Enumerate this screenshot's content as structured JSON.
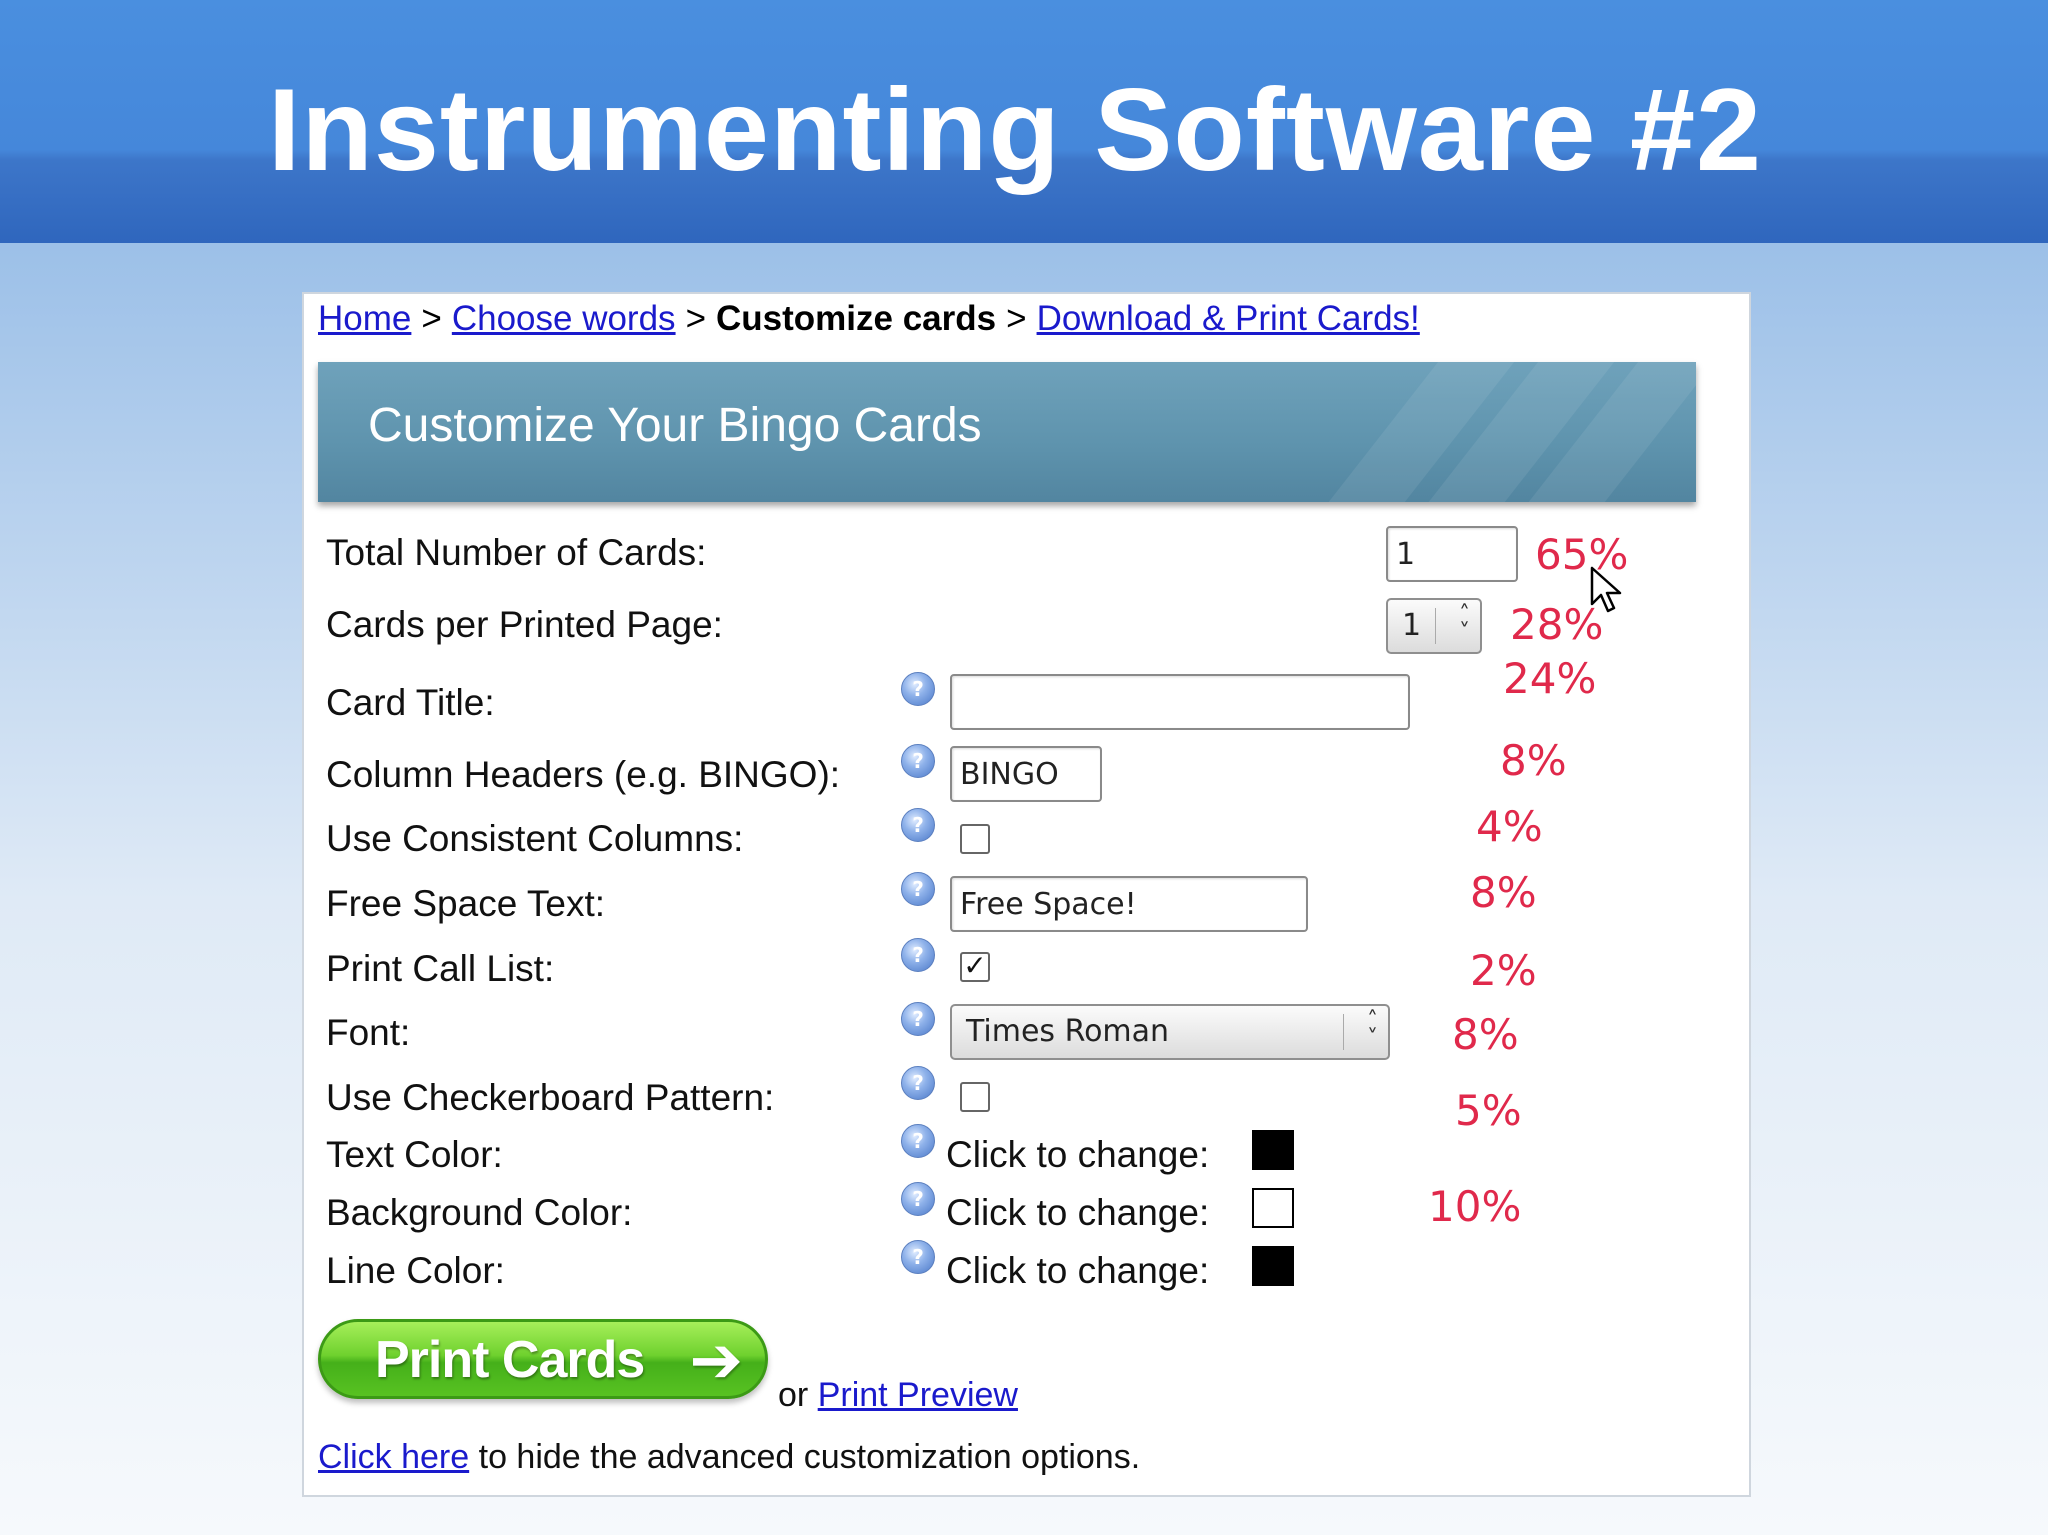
{
  "slide": {
    "title": "Instrumenting Software #2"
  },
  "breadcrumb": {
    "home": "Home",
    "sep1": ">",
    "choose": "Choose words",
    "sep2": ">",
    "current": "Customize cards",
    "sep3": ">",
    "download": "Download & Print Cards!"
  },
  "banner": {
    "title": "Customize Your Bingo Cards"
  },
  "form": {
    "total_cards": {
      "label": "Total Number of Cards:",
      "value": "1",
      "pct": "65%"
    },
    "cards_per_page": {
      "label": "Cards per Printed Page:",
      "value": "1",
      "pct": "28%"
    },
    "card_title": {
      "label": "Card Title:",
      "value": "",
      "pct": "24%"
    },
    "column_headers": {
      "label": "Column Headers (e.g. BINGO):",
      "value": "BINGO",
      "pct": "8%"
    },
    "consistent_columns": {
      "label": "Use Consistent Columns:",
      "checked": false,
      "pct": "4%"
    },
    "free_space": {
      "label": "Free Space Text:",
      "value": "Free Space!",
      "pct": "8%"
    },
    "print_call_list": {
      "label": "Print Call List:",
      "checked": true,
      "pct": "2%"
    },
    "font": {
      "label": "Font:",
      "value": "Times Roman",
      "pct": "8%"
    },
    "checkerboard": {
      "label": "Use Checkerboard Pattern:",
      "checked": false,
      "pct": "5%"
    },
    "text_color": {
      "label": "Text Color:",
      "change": "Click to change:",
      "color": "#000000"
    },
    "background_color": {
      "label": "Background Color:",
      "change": "Click to change:",
      "color": "#ffffff",
      "pct": "10%"
    },
    "line_color": {
      "label": "Line Color:",
      "change": "Click to change:",
      "color": "#000000"
    }
  },
  "actions": {
    "print_button": "Print Cards",
    "or": "or",
    "preview_link": "Print Preview",
    "click_here": "Click here",
    "hide_text": "to hide the advanced customization options."
  },
  "colors": {
    "header_blue": "#3d76c9",
    "banner_teal": "#5e93ad",
    "link": "#1a1acc",
    "annotation_red": "#e0294b",
    "button_green": "#6fd12e"
  },
  "icons": {
    "help": "help-question-icon",
    "cursor": "mouse-pointer-icon",
    "arrow": "arrow-right-icon",
    "spinner": "up-down-chevron-icon"
  }
}
